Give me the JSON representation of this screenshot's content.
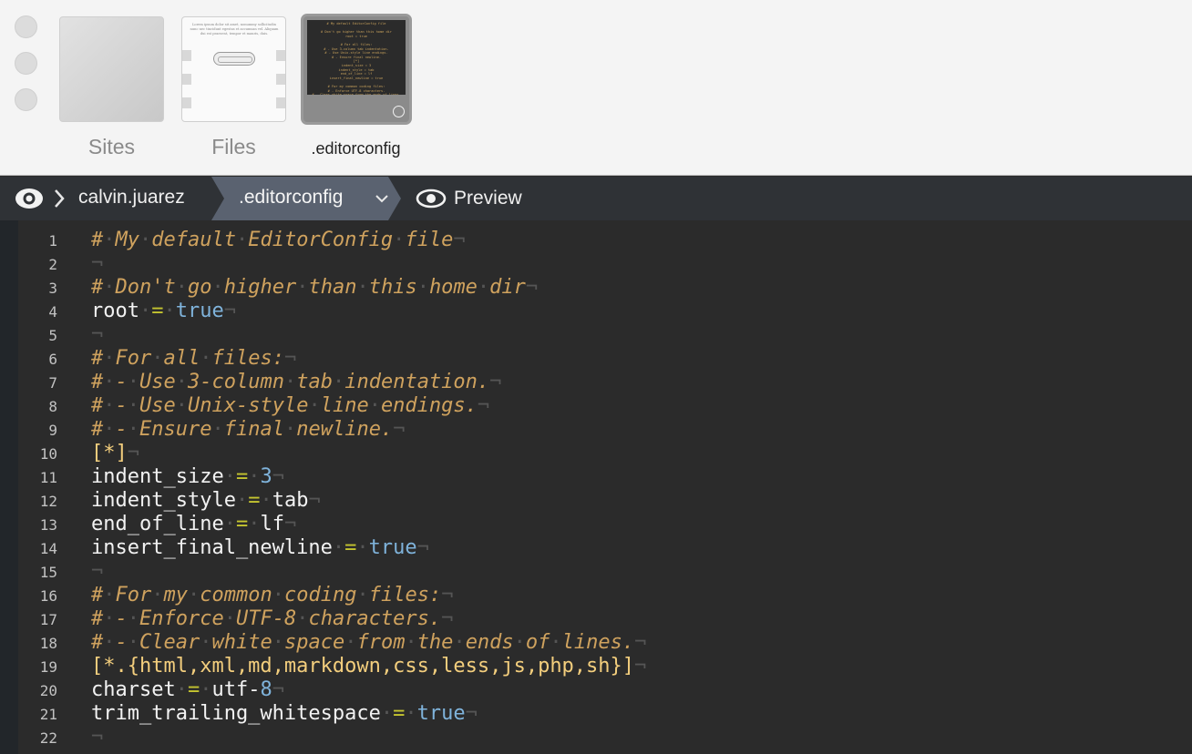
{
  "tabs": [
    {
      "label": "Sites"
    },
    {
      "label": "Files"
    },
    {
      "label": ".editorconfig"
    }
  ],
  "files_thumb_text": "Lorem ipsum dolor sit amet, nonummy sollicitudin nunc nec tincidunt egestas et accumsan vel. Aliquam dui est praesent, tempor et mauris, duis.",
  "breadcrumb": {
    "user": "calvin.juarez",
    "file": ".editorconfig",
    "preview": "Preview"
  },
  "colors": {
    "comment": "#cfa25e",
    "section": "#f3ce7d",
    "operator": "#c5c530",
    "value": "#7fb3db"
  },
  "invisibles": {
    "space": "·",
    "eol": "¬"
  },
  "editor": {
    "lines": [
      {
        "n": "1",
        "type": "comment",
        "text": "# My default EditorConfig file"
      },
      {
        "n": "2",
        "type": "empty",
        "text": ""
      },
      {
        "n": "3",
        "type": "comment",
        "text": "# Don't go higher than this home dir"
      },
      {
        "n": "4",
        "type": "kv",
        "key": "root",
        "value": "true",
        "value_type": "bool"
      },
      {
        "n": "5",
        "type": "empty",
        "text": ""
      },
      {
        "n": "6",
        "type": "comment",
        "text": "# For all files:"
      },
      {
        "n": "7",
        "type": "comment",
        "text": "# - Use 3-column tab indentation."
      },
      {
        "n": "8",
        "type": "comment",
        "text": "# - Use Unix-style line endings."
      },
      {
        "n": "9",
        "type": "comment",
        "text": "# - Ensure final newline."
      },
      {
        "n": "10",
        "type": "section",
        "text": "[*]"
      },
      {
        "n": "11",
        "type": "kv",
        "key": "indent_size",
        "value": "3",
        "value_type": "number"
      },
      {
        "n": "12",
        "type": "kv",
        "key": "indent_style",
        "value": "tab",
        "value_type": "plain"
      },
      {
        "n": "13",
        "type": "kv",
        "key": "end_of_line",
        "value": "lf",
        "value_type": "plain"
      },
      {
        "n": "14",
        "type": "kv",
        "key": "insert_final_newline",
        "value": "true",
        "value_type": "bool"
      },
      {
        "n": "15",
        "type": "empty",
        "text": ""
      },
      {
        "n": "16",
        "type": "comment",
        "text": "# For my common coding files:"
      },
      {
        "n": "17",
        "type": "comment",
        "text": "# - Enforce UTF-8 characters."
      },
      {
        "n": "18",
        "type": "comment",
        "text": "# - Clear white space from the ends of lines."
      },
      {
        "n": "19",
        "type": "section",
        "text": "[*.{html,xml,md,markdown,css,less,js,php,sh}]"
      },
      {
        "n": "20",
        "type": "kv",
        "key": "charset",
        "value": "utf-8",
        "value_type": "utf"
      },
      {
        "n": "21",
        "type": "kv",
        "key": "trim_trailing_whitespace",
        "value": "true",
        "value_type": "bool"
      },
      {
        "n": "22",
        "type": "empty",
        "text": ""
      }
    ]
  }
}
